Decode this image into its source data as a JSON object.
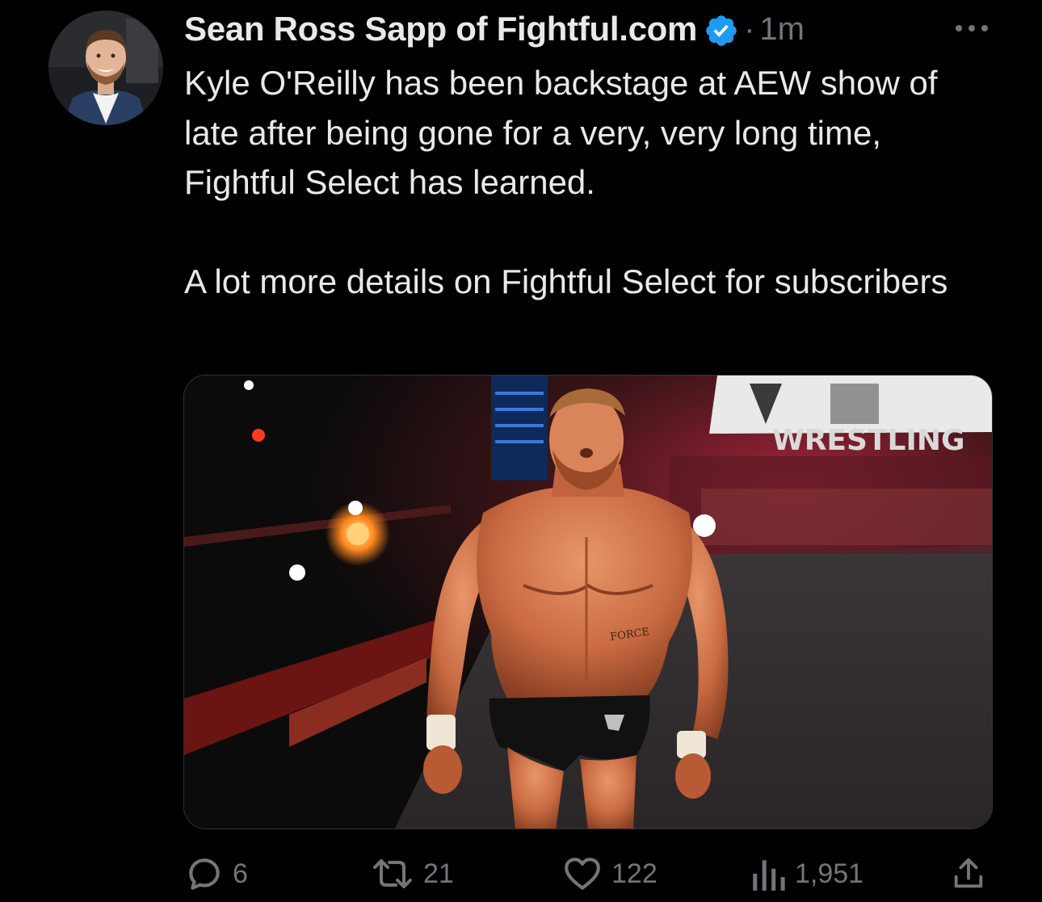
{
  "author": {
    "display_name": "Sean Ross Sapp of Fightful.com",
    "verified": true,
    "separator": "·",
    "time": "1m",
    "avatar_icon": "profile-photo"
  },
  "tweet": {
    "paragraphs": [
      "Kyle O'Reilly has been backstage at AEW show of late after being gone for a very, very long time, Fightful Select has learned.",
      "A lot more details on Fightful Select for subscribers"
    ]
  },
  "media": {
    "icon": "wrestler-photo",
    "sign_text": "WRESTLING",
    "tattoo_text": "FORCE"
  },
  "actions": {
    "replies": "6",
    "reposts": "21",
    "likes": "122",
    "views": "1,951"
  },
  "colors": {
    "background": "#000000",
    "text": "#e7e9ea",
    "muted": "#71767b",
    "verified_blue": "#1d9bf0"
  }
}
